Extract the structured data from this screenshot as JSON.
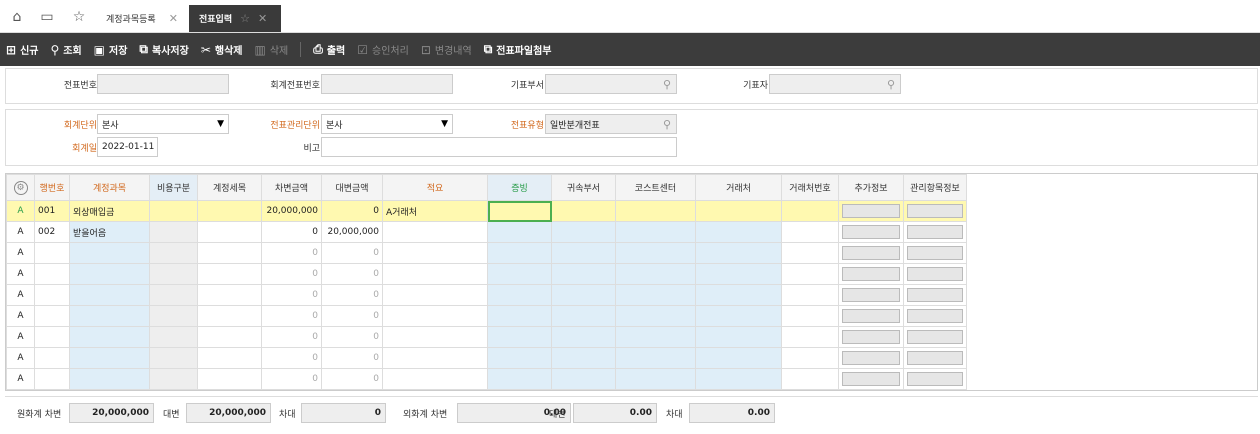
{
  "tabbar": {
    "icons": [
      "home-icon",
      "print-stack-icon",
      "star-icon"
    ],
    "tabs": [
      {
        "label": "계정과목등록",
        "close": "✕"
      },
      {
        "label": "전표입력",
        "close": "✕",
        "fav": "☆"
      }
    ]
  },
  "toolbar": {
    "new": "신규",
    "search": "조회",
    "save": "저장",
    "copy_save": "복사저장",
    "delete_row": "행삭제",
    "delete": "삭제",
    "print": "출력",
    "approve": "승인처리",
    "history": "변경내역",
    "attach": "전표파일첨부"
  },
  "filter1": {
    "voucher_no_label": "전표번호",
    "voucher_no": "",
    "acct_voucher_no_label": "회계전표번호",
    "acct_voucher_no": "",
    "dept_label": "기표부서",
    "dept": "",
    "writer_label": "기표자",
    "writer": ""
  },
  "filter2": {
    "unit_label": "회계단위",
    "unit": "본사",
    "mgmt_unit_label": "전표관리단위",
    "mgmt_unit": "본사",
    "type_label": "전표유형",
    "type": "일반분개전표",
    "date_label": "회계일",
    "date": "2022-01-11",
    "memo_label": "비고",
    "memo": ""
  },
  "grid": {
    "headers": [
      "행번호",
      "계정과목",
      "비용구분",
      "계정세목",
      "차변금액",
      "대변금액",
      "적요",
      "증빙",
      "귀속부서",
      "코스트센터",
      "거래처",
      "거래처번호",
      "추가정보",
      "관리항목정보"
    ],
    "rows": [
      {
        "flag": "A",
        "no": "001",
        "account": "외상매입금",
        "debit": "20,000,000",
        "credit": "0",
        "memo": "A거래처"
      },
      {
        "flag": "A",
        "no": "002",
        "account": "받을어음",
        "debit": "0",
        "credit": "20,000,000",
        "memo": ""
      },
      {
        "flag": "A",
        "no": "",
        "account": "",
        "debit": "0",
        "credit": "0",
        "memo": ""
      },
      {
        "flag": "A",
        "no": "",
        "account": "",
        "debit": "0",
        "credit": "0",
        "memo": ""
      },
      {
        "flag": "A",
        "no": "",
        "account": "",
        "debit": "0",
        "credit": "0",
        "memo": ""
      },
      {
        "flag": "A",
        "no": "",
        "account": "",
        "debit": "0",
        "credit": "0",
        "memo": ""
      },
      {
        "flag": "A",
        "no": "",
        "account": "",
        "debit": "0",
        "credit": "0",
        "memo": ""
      },
      {
        "flag": "A",
        "no": "",
        "account": "",
        "debit": "0",
        "credit": "0",
        "memo": ""
      },
      {
        "flag": "A",
        "no": "",
        "account": "",
        "debit": "0",
        "credit": "0",
        "memo": ""
      }
    ]
  },
  "footer": {
    "krw_debit_label": "원화계 차변",
    "krw_debit": "20,000,000",
    "krw_credit_label": "대변",
    "krw_credit": "20,000,000",
    "krw_diff_label": "차대",
    "krw_diff": "0",
    "fx_debit_label": "외화계 차변",
    "fx_debit": "0.00",
    "fx_credit_label": "대변",
    "fx_credit": "0.00",
    "fx_diff_label": "차대",
    "fx_diff": "0.00"
  }
}
